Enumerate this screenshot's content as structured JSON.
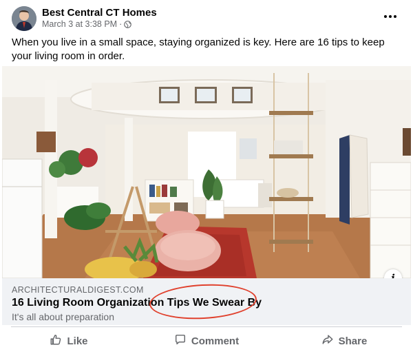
{
  "post": {
    "author": "Best Central CT Homes",
    "date": "March 3 at 3:38 PM",
    "separator": "·",
    "privacy_icon": "globe-icon",
    "more_icon": "ellipsis-icon",
    "text": "When you live in a small space, staying organized is key. Here are 16 tips to keep your living room in order."
  },
  "link": {
    "domain": "ARCHITECTURALDIGEST.COM",
    "title": "16 Living Room Organization Tips We Swear By",
    "subtitle": "It's all about preparation",
    "info_icon": "i"
  },
  "annotation": {
    "circle_color": "#e0412d"
  },
  "actions": {
    "like": "Like",
    "comment": "Comment",
    "share": "Share"
  },
  "colors": {
    "secondary_text": "#65676b",
    "preview_bg": "#f0f2f5",
    "divider": "#ced0d4"
  }
}
